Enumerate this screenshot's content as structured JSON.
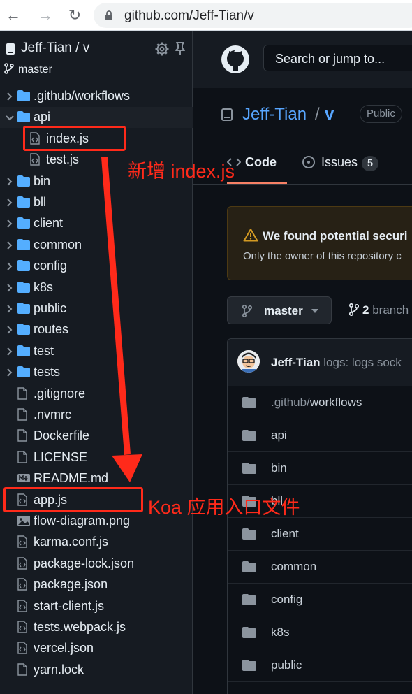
{
  "browser": {
    "back_icon": "arrow-left-icon",
    "forward_icon": "arrow-right-icon",
    "reload_icon": "reload-icon",
    "url": "github.com/Jeff-Tian/v"
  },
  "sidebar": {
    "repo_title": "Jeff-Tian / v",
    "branch": "master",
    "items": [
      {
        "label": ".github/workflows",
        "kind": "folder",
        "expanded": false
      },
      {
        "label": "api",
        "kind": "folder",
        "expanded": true
      },
      {
        "label": "index.js",
        "kind": "file"
      },
      {
        "label": "test.js",
        "kind": "file"
      },
      {
        "label": "bin",
        "kind": "folder"
      },
      {
        "label": "bll",
        "kind": "folder"
      },
      {
        "label": "client",
        "kind": "folder"
      },
      {
        "label": "common",
        "kind": "folder"
      },
      {
        "label": "config",
        "kind": "folder"
      },
      {
        "label": "k8s",
        "kind": "folder"
      },
      {
        "label": "public",
        "kind": "folder"
      },
      {
        "label": "routes",
        "kind": "folder"
      },
      {
        "label": "test",
        "kind": "folder"
      },
      {
        "label": "tests",
        "kind": "folder"
      },
      {
        "label": ".gitignore",
        "kind": "doc"
      },
      {
        "label": ".nvmrc",
        "kind": "doc"
      },
      {
        "label": "Dockerfile",
        "kind": "doc"
      },
      {
        "label": "LICENSE",
        "kind": "doc"
      },
      {
        "label": "README.md",
        "kind": "markdown"
      },
      {
        "label": "app.js",
        "kind": "file"
      },
      {
        "label": "flow-diagram.png",
        "kind": "image"
      },
      {
        "label": "karma.conf.js",
        "kind": "file"
      },
      {
        "label": "package-lock.json",
        "kind": "file"
      },
      {
        "label": "package.json",
        "kind": "file"
      },
      {
        "label": "start-client.js",
        "kind": "file"
      },
      {
        "label": "tests.webpack.js",
        "kind": "file"
      },
      {
        "label": "vercel.json",
        "kind": "file"
      },
      {
        "label": "yarn.lock",
        "kind": "doc"
      }
    ]
  },
  "header": {
    "search_placeholder": "Search or jump to..."
  },
  "repo": {
    "owner": "Jeff-Tian",
    "slash": "/",
    "name": "v",
    "visibility": "Public"
  },
  "tabs": [
    {
      "label": "Code",
      "active": true
    },
    {
      "label": "Issues",
      "count": "5"
    }
  ],
  "alert": {
    "title": "We found potential securi",
    "body": "Only the owner of this repository c"
  },
  "branch_selector": {
    "label": "master",
    "branches_count": "2",
    "branches_label": "branch"
  },
  "commit": {
    "author": "Jeff-Tian",
    "message": "logs: logs sock"
  },
  "files": [
    {
      "prefix": ".github/",
      "name": "workflows"
    },
    {
      "prefix": "",
      "name": "api"
    },
    {
      "prefix": "",
      "name": "bin"
    },
    {
      "prefix": "",
      "name": "bll"
    },
    {
      "prefix": "",
      "name": "client"
    },
    {
      "prefix": "",
      "name": "common"
    },
    {
      "prefix": "",
      "name": "config"
    },
    {
      "prefix": "",
      "name": "k8s"
    },
    {
      "prefix": "",
      "name": "public"
    }
  ],
  "annotations": {
    "index_note": "新增 index.js",
    "app_note": "Koa 应用入口文件",
    "color": "#ff2a1a"
  },
  "colors": {
    "accent": "#58a6ff",
    "folder": "#54aeff",
    "background": "#0d1117",
    "sidebar": "#161b22"
  }
}
